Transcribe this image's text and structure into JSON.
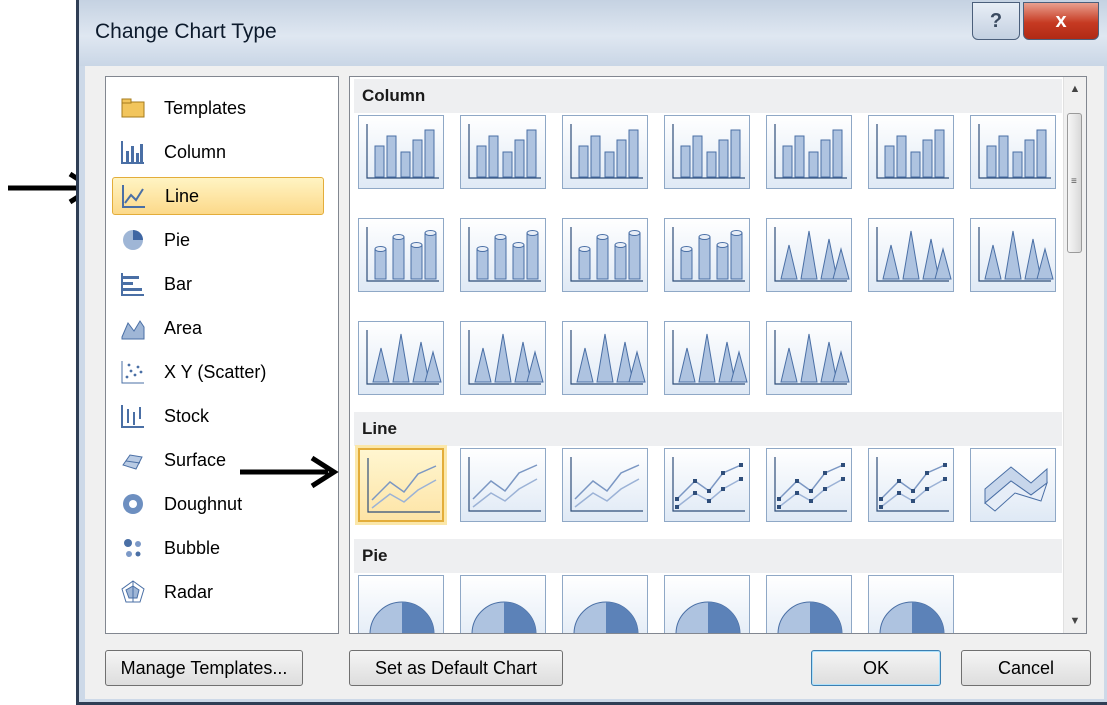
{
  "window": {
    "title": "Change Chart Type",
    "help_glyph": "?",
    "close_glyph": "x"
  },
  "chart_types": [
    {
      "label": "Templates",
      "icon": "folder-icon"
    },
    {
      "label": "Column",
      "icon": "column-chart-icon"
    },
    {
      "label": "Line",
      "icon": "line-chart-icon",
      "selected": true
    },
    {
      "label": "Pie",
      "icon": "pie-chart-icon"
    },
    {
      "label": "Bar",
      "icon": "bar-chart-icon"
    },
    {
      "label": "Area",
      "icon": "area-chart-icon"
    },
    {
      "label": "X Y (Scatter)",
      "icon": "scatter-chart-icon"
    },
    {
      "label": "Stock",
      "icon": "stock-chart-icon"
    },
    {
      "label": "Surface",
      "icon": "surface-chart-icon"
    },
    {
      "label": "Doughnut",
      "icon": "doughnut-chart-icon"
    },
    {
      "label": "Bubble",
      "icon": "bubble-chart-icon"
    },
    {
      "label": "Radar",
      "icon": "radar-chart-icon"
    }
  ],
  "gallery": {
    "sections": [
      {
        "title": "Column",
        "rows": [
          [
            "clustered-column",
            "stacked-column",
            "100-stacked-column",
            "3d-clustered-column",
            "3d-stacked-column",
            "3d-100-stacked-column",
            "3d-column"
          ],
          [
            "clustered-cylinder",
            "stacked-cylinder",
            "100-stacked-cylinder",
            "3d-cylinder",
            "clustered-cone",
            "stacked-cone",
            "100-stacked-cone"
          ],
          [
            "3d-cone",
            "clustered-pyramid",
            "stacked-pyramid",
            "100-stacked-pyramid",
            "3d-pyramid"
          ]
        ]
      },
      {
        "title": "Line",
        "rows": [
          [
            "line",
            "stacked-line",
            "100-stacked-line",
            "line-with-markers",
            "stacked-line-with-markers",
            "100-stacked-line-with-markers",
            "3d-line"
          ]
        ]
      },
      {
        "title": "Pie",
        "rows": [
          [
            "pie",
            "3d-pie",
            "pie-of-pie",
            "exploded-pie",
            "3d-exploded-pie",
            "bar-of-pie"
          ]
        ]
      }
    ],
    "selected": "line"
  },
  "buttons": {
    "manage_templates": "Manage Templates...",
    "set_default": "Set as Default Chart",
    "ok": "OK",
    "cancel": "Cancel"
  },
  "colors": {
    "selection_fill": "#fcd98a",
    "selection_border": "#e3ad3a",
    "icon_blue": "#4a6fa5"
  }
}
